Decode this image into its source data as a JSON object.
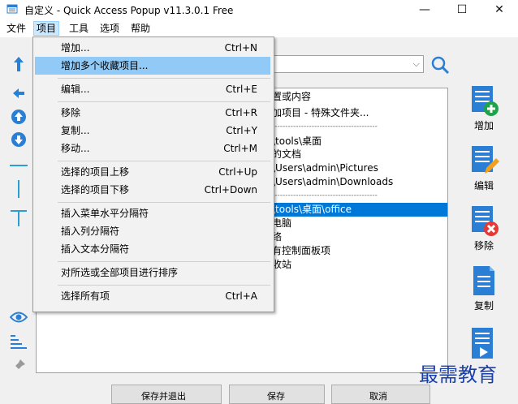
{
  "window": {
    "title": "自定义 - Quick Access Popup v11.3.0.1 Free",
    "minimize": "—",
    "maximize": "☐",
    "close": "✕"
  },
  "menubar": [
    "文件",
    "项目",
    "工具",
    "选项",
    "帮助"
  ],
  "dropdown": {
    "items": [
      {
        "label": "增加...",
        "shortcut": "Ctrl+N"
      },
      {
        "label": "增加多个收藏项目...",
        "shortcut": ""
      },
      {
        "label": "编辑...",
        "shortcut": "Ctrl+E"
      },
      {
        "label": "移除",
        "shortcut": "Ctrl+R"
      },
      {
        "label": "复制...",
        "shortcut": "Ctrl+Y"
      },
      {
        "label": "移动...",
        "shortcut": "Ctrl+M"
      },
      {
        "label": "选择的项目上移",
        "shortcut": "Ctrl+Up"
      },
      {
        "label": "选择的项目下移",
        "shortcut": "Ctrl+Down"
      },
      {
        "label": "插入菜单水平分隔符",
        "shortcut": ""
      },
      {
        "label": "插入列分隔符",
        "shortcut": ""
      },
      {
        "label": "插入文本分隔符",
        "shortcut": ""
      },
      {
        "label": "对所选或全部项目进行排序",
        "shortcut": ""
      },
      {
        "label": "选择所有项",
        "shortcut": "Ctrl+A"
      }
    ]
  },
  "list": {
    "rows": [
      "置或内容",
      "加项目 - 特殊文件夹...",
      "----------------------------------------",
      "\\tools\\桌面",
      "的文档",
      "\\Users\\admin\\Pictures",
      "\\Users\\admin\\Downloads",
      "----------------------------------------",
      "\\tools\\桌面\\office",
      "电脑",
      "络",
      "有控制面板项",
      "收站"
    ]
  },
  "right_toolbar": [
    "增加",
    "编辑",
    "移除",
    "复制"
  ],
  "bottom_buttons": [
    "保存并退出",
    "保存",
    "取消"
  ],
  "watermark": "最需教育",
  "colors": {
    "accent": "#0078d7",
    "highlight": "#91c9f7",
    "icon_blue": "#2a7fd4",
    "add_green": "#1fa34a",
    "remove_red": "#e53935",
    "edit_orange": "#f0a020"
  }
}
